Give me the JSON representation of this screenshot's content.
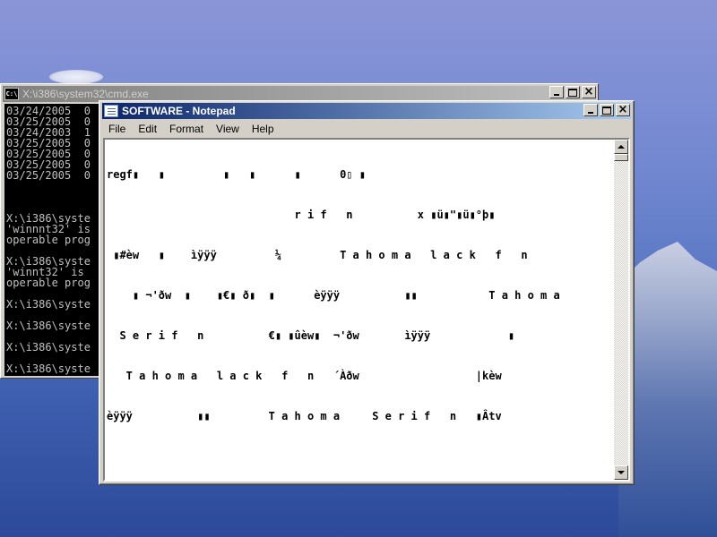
{
  "cmd": {
    "title": "X:\\i386\\system32\\cmd.exe",
    "icon": "cmd-icon",
    "lines": [
      "03/24/2005  0",
      "03/25/2005  0",
      "03/24/2003  1",
      "03/25/2005  0",
      "03/25/2005  0",
      "03/25/2005  0",
      "03/25/2005  0",
      "",
      "",
      "",
      "X:\\i386\\syste",
      "'winnnt32' is",
      "operable prog",
      "",
      "X:\\i386\\syste",
      "'winnt32' is",
      "operable prog",
      "",
      "X:\\i386\\syste",
      "",
      "X:\\i386\\syste",
      "",
      "X:\\i386\\syste",
      "",
      "X:\\i386\\syste"
    ]
  },
  "notepad": {
    "title": "SOFTWARE - Notepad",
    "icon": "notepad-icon",
    "menu": [
      "File",
      "Edit",
      "Format",
      "View",
      "Help"
    ],
    "lines": [
      "regf▮   ▮         ▮   ▮      ▮      0▯ ▮",
      "                             r i f   n          x ▮ü▮\"▮ü▮°þ▮",
      " ▮#èw   ▮    ìÿÿÿ         ¼         T a h o m a   l a c k   f   n",
      "    ▮ ¬'ðw  ▮    ▮€▮ ð▮  ▮      èÿÿÿ          ▮▮           T a h o m a",
      "  S e r i f   n          €▮ ▮ûèw▮  ¬'ðw       ìÿÿÿ            ▮",
      "   T a h o m a   l a c k   f   n   ´Àðw                  |kèw",
      "èÿÿÿ          ▮▮         T a h o m a     S e r i f   n   ▮Âtv"
    ]
  }
}
